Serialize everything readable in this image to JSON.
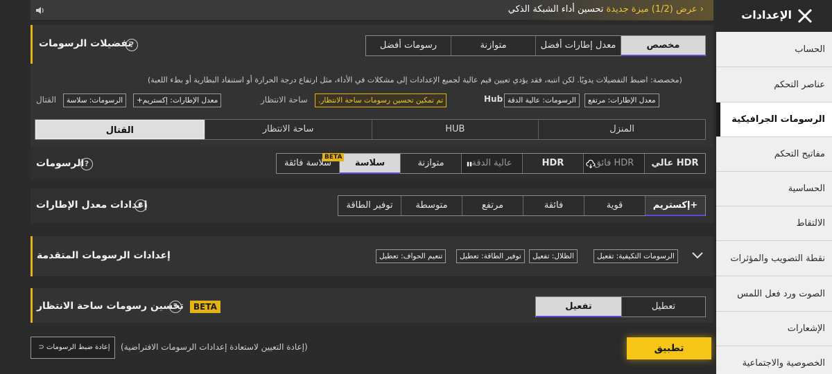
{
  "sidebar": {
    "title": "الإعدادات",
    "items": [
      {
        "label": "الحساب"
      },
      {
        "label": "عناصر التحكم"
      },
      {
        "label": "الرسومات الجرافيكية"
      },
      {
        "label": "مفاتيح التحكم"
      },
      {
        "label": "الحساسية"
      },
      {
        "label": "الالتقاط"
      },
      {
        "label": "نقطة التصويب والمؤثرات"
      },
      {
        "label": "الصوت ورد فعل اللمس"
      },
      {
        "label": "الإشعارات"
      },
      {
        "label": "الخصوصية والاجتماعية"
      }
    ],
    "active_index": 2
  },
  "banner": {
    "offer": "عرض (1/2)",
    "new_feature": "ميزة جديدة",
    "feature_text": "تحسين أداء الشبكة الذكي"
  },
  "graphics_prefs": {
    "title": "تفضيلات الرسومات",
    "options": [
      "مخصص",
      "معدل إطارات أفضل",
      "متوازنة",
      "رسومات أفضل"
    ],
    "selected": "مخصص",
    "description": "(مخصصة: اضبط التفضيلات يدويًا. لكن انتبه، فقد يؤدي تعيين قيم عالية لجميع الإعدادات إلى مشكلات في الأداء، مثل ارتفاع درجة الحرارة أو استنفاد البطارية أو بطء اللعبة)",
    "hub_label": "Hub",
    "hub_chips": [
      "معدل الإطارات: مرتفع",
      "الرسومات: عالية الدقة"
    ],
    "lobby_label": "ساحة الانتظار",
    "lobby_notice": "تم تمكين تحسين رسومات ساحة الانتظار.",
    "combat_label": "القتال",
    "combat_chips": [
      "معدل الإطارات: إكستريم+",
      "الرسومات: سلاسة"
    ]
  },
  "tabs": {
    "items": [
      "المنزل",
      "HUB",
      "ساحة الانتظار",
      "القتال"
    ],
    "selected": "القتال"
  },
  "graphics": {
    "label": "الرسومات",
    "options": [
      "عالي HDR",
      "فائق HDR",
      "HDR",
      "عالية الدقة",
      "متوازنة",
      "سلاسة",
      "سلاسة فائقة"
    ],
    "selected": "سلاسة",
    "beta": "BETA"
  },
  "frame_rate": {
    "label": "إعدادات معدل الإطارات",
    "options": [
      "إكستريم+",
      "قوية",
      "فائقة",
      "مرتفع",
      "متوسطة",
      "توفير الطاقة"
    ],
    "selected": "إكستريم+"
  },
  "advanced": {
    "title": "إعدادات الرسومات المتقدمة",
    "chips": [
      "الرسومات التكيفية: تفعيل",
      "الظلال: تفعيل",
      "توفير الطاقة: تعطيل",
      "تنعيم الحواف: تعطيل"
    ]
  },
  "lobby_enhance": {
    "title": "تحسين رسومات ساحة الانتظار",
    "beta": "BETA",
    "options": [
      "تعطيل",
      "تفعيل"
    ],
    "selected": "تفعيل"
  },
  "footer": {
    "apply": "تطبيق",
    "reset": "إعادة ضبط الرسومات",
    "hint": "(إعادة التعيين لاستعادة إعدادات الرسومات الافتراضية)"
  },
  "colors": {
    "accent": "#e6b316",
    "selected_underline": "#5a4ae0",
    "sidebar_bg": "#efefef"
  }
}
